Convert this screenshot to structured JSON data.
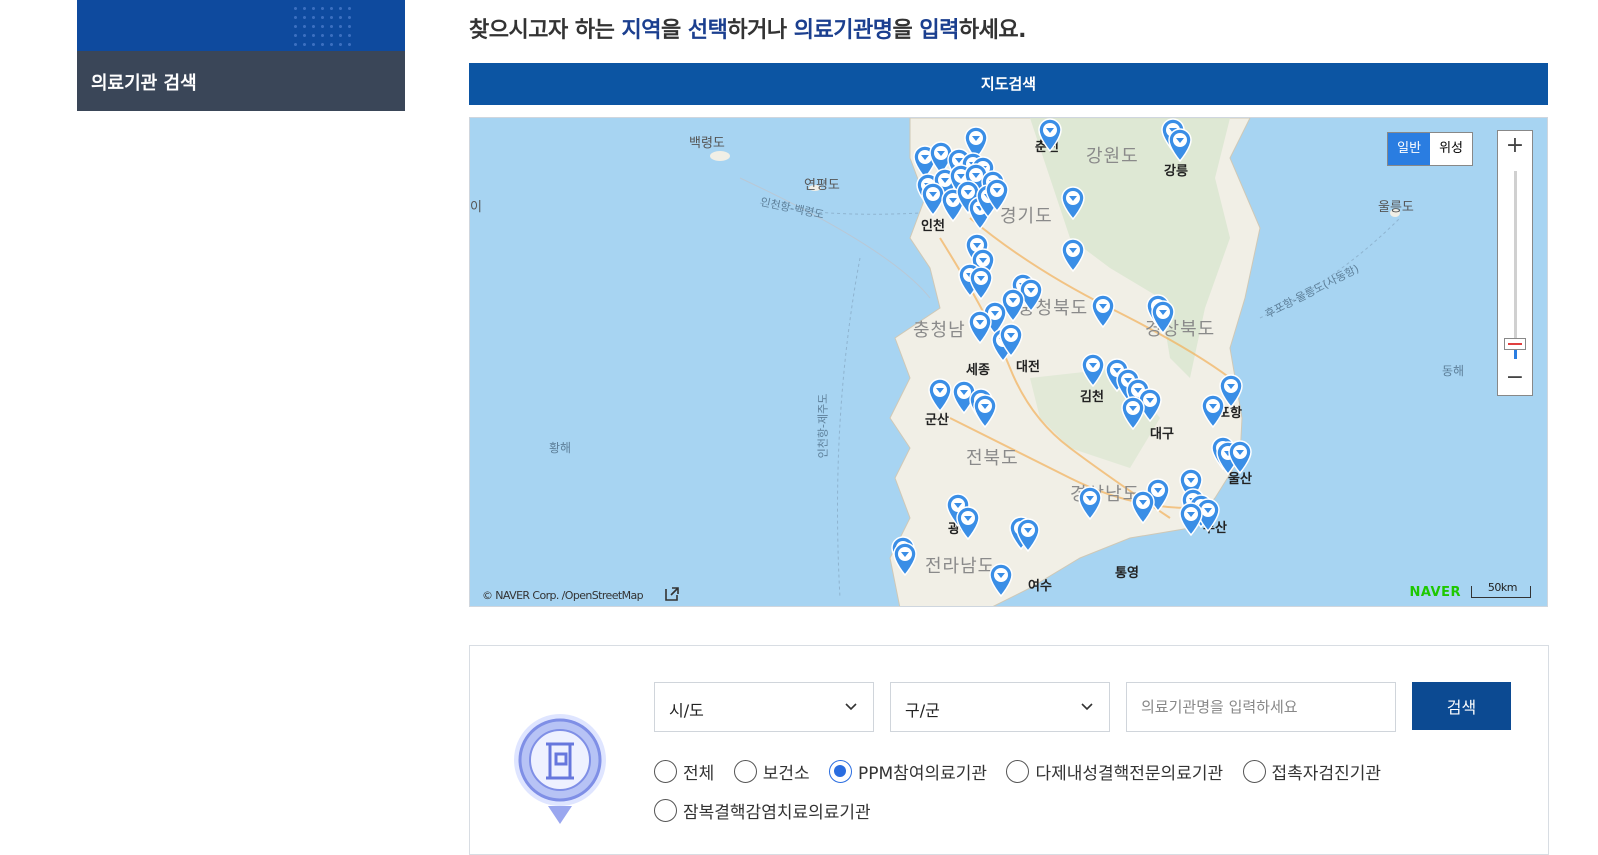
{
  "sidebar": {
    "item_label": "의료기관 검색"
  },
  "headline": {
    "part1": "찾으시고자 하는 ",
    "hl1": "지역",
    "part2": "을 ",
    "hl2": "선택",
    "part3": "하거나 ",
    "hl3": "의료기관명",
    "part4": "을 ",
    "hl4": "입력",
    "part5": "하세요."
  },
  "map": {
    "header_label": "지도검색",
    "type_buttons": [
      "일반",
      "위성"
    ],
    "active_type": "일반",
    "copyright": "© NAVER Corp. /OpenStreetMap",
    "brand": "NAVER",
    "scale_label": "50km",
    "zoom_in": "+",
    "zoom_out": "−",
    "labels": {
      "baengnyeongdo": "백령도",
      "yeonpyeongdo": "연평도",
      "route1": "인천항-백령도",
      "route2": "인천항-제주도",
      "route3": "후포항-울릉도(사동항)",
      "ulleungdo": "울릉도",
      "chuncheon": "춘천",
      "gangwondo": "강원도",
      "gangneung": "강릉",
      "gyeonggido": "경기도",
      "incheon": "인천",
      "chungbuk": "충청북도",
      "chungnam": "충청남",
      "gyeongbuk": "경상북도",
      "sejong": "세종",
      "daejeon": "대전",
      "gimcheon": "김천",
      "pohang": "포항",
      "daegu": "대구",
      "gunsan": "군산",
      "jeonbuk": "전북도",
      "ulsan": "울산",
      "gyeongnam": "경상남도",
      "busan": "부산",
      "gwangju": "광주",
      "jeonnam": "전라남도",
      "tongyeong": "통영",
      "yeosu": "여수",
      "yellow_sea": "황해",
      "east_sea": "동해",
      "west_edge": "이"
    }
  },
  "search": {
    "sido_label": "시/도",
    "gugun_label": "구/군",
    "name_placeholder": "의료기관명을 입력하세요",
    "name_value": "",
    "search_button": "검색",
    "radio_options": [
      "전체",
      "보건소",
      "PPM참여의료기관",
      "다제내성결핵전문의료기관",
      "접촉자검진기관",
      "잠복결핵감염치료의료기관"
    ],
    "selected_option": "PPM참여의료기관"
  },
  "colors": {
    "brand_blue": "#0c55a3",
    "sidebar_dark": "#3a4658",
    "pin_blue": "#3a8ee6",
    "radio_selected": "#2a6de0"
  }
}
